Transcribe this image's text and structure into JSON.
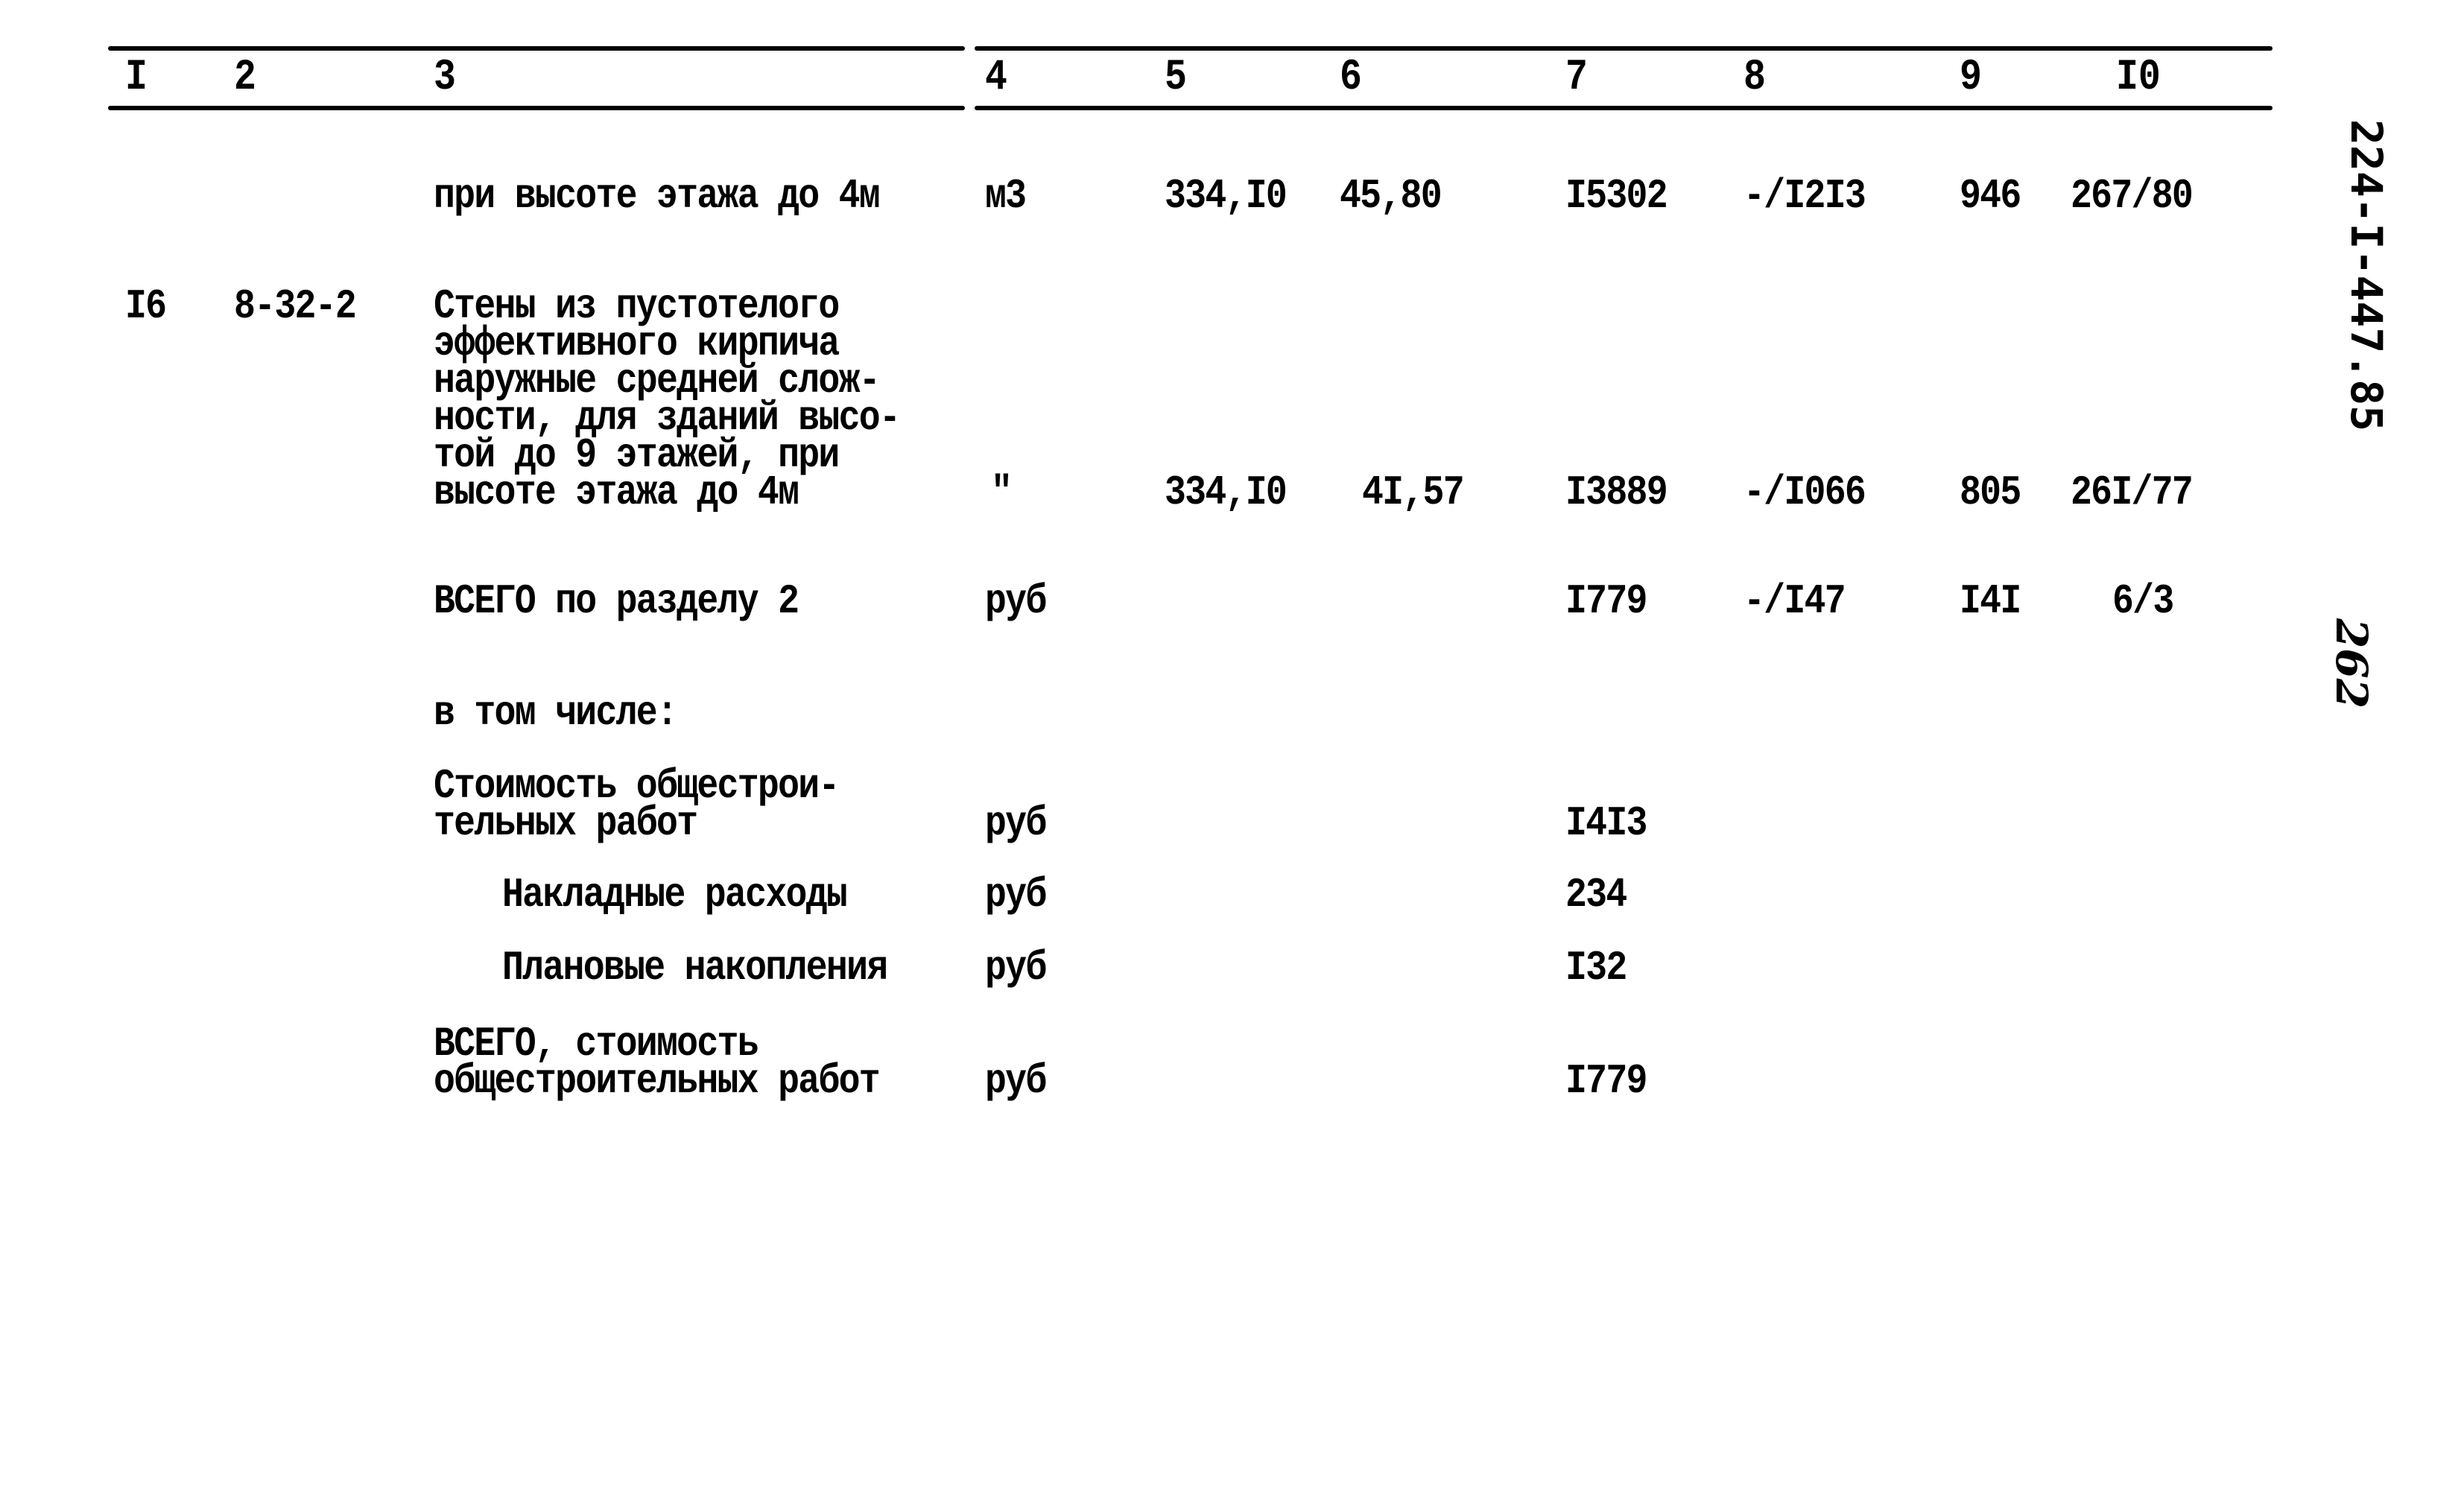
{
  "header": {
    "columns": [
      "I",
      "2",
      "3",
      "4",
      "5",
      "6",
      "7",
      "8",
      "9",
      "I0"
    ]
  },
  "side_label": {
    "doc_code": "224-I-447.85",
    "page_number": "262"
  },
  "rows": [
    {
      "col1": "",
      "col2": "",
      "description": [
        "при высоте этажа до 4м"
      ],
      "unit": "м3",
      "col5": "334,I0",
      "col6": "45,80",
      "col7": "I5302",
      "col8": "-/I2I3",
      "col9": "946",
      "col10": "267/80"
    },
    {
      "col1": "I6",
      "col2": "8-32-2",
      "description": [
        "Стены из пустотелого",
        "эффективного кирпича",
        "наружные средней слож-",
        "ности, для зданий высо-",
        "той до 9 этажей, при",
        "высоте этажа до 4м"
      ],
      "unit": "\"",
      "col5": "334,I0",
      "col6": "4I,57",
      "col7": "I3889",
      "col8": "-/I066",
      "col9": "805",
      "col10": "26I/77"
    },
    {
      "description": [
        "ВСЕГО по разделу 2"
      ],
      "unit": "руб",
      "col7": "I779",
      "col8": "-/I47",
      "col9": "I4I",
      "col10": "6/3"
    },
    {
      "description": [
        "в том числе:"
      ]
    },
    {
      "description": [
        "Стоимость общестрои-",
        "тельных работ"
      ],
      "unit": "руб",
      "col7": "I4I3"
    },
    {
      "description": [
        "Накладные расходы"
      ],
      "unit": "руб",
      "col7": "234"
    },
    {
      "description": [
        "Плановые накопления"
      ],
      "unit": "руб",
      "col7": "I32"
    },
    {
      "description": [
        "ВСЕГО, стоимость",
        "общестроительных работ"
      ],
      "unit": "руб",
      "col7": "I779"
    }
  ]
}
